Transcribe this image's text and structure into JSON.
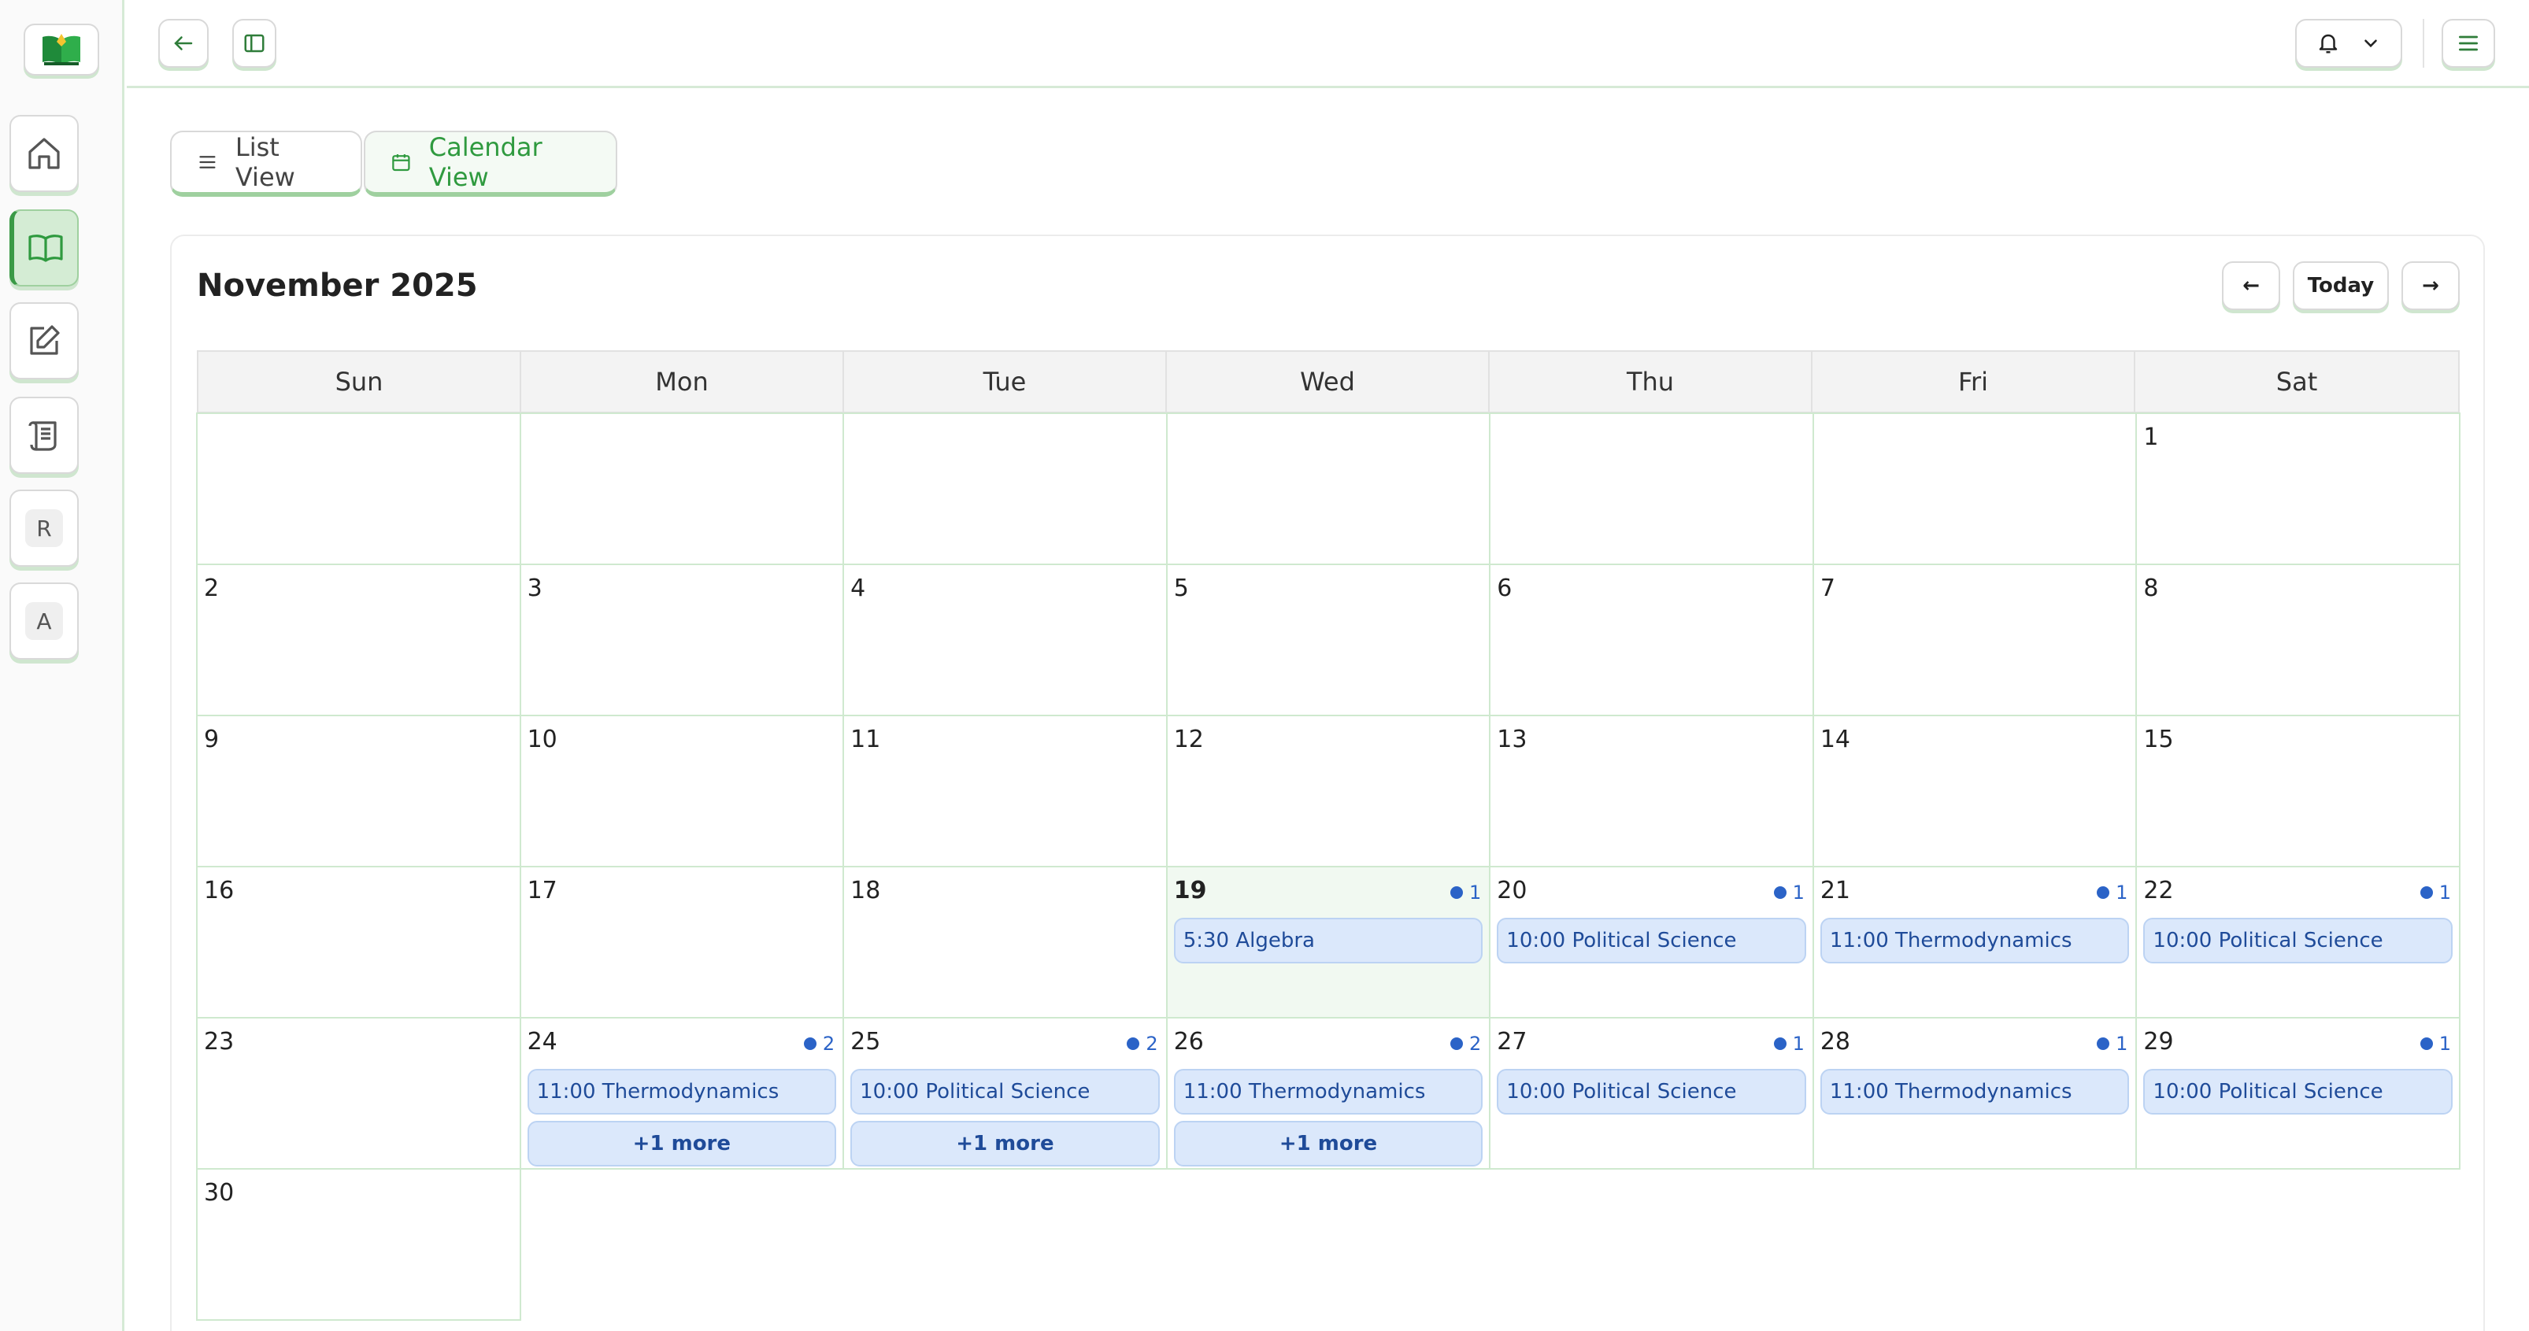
{
  "sidebar": {
    "logo_icon": "open-book-logo",
    "items": [
      {
        "name": "home",
        "icon": "home-icon"
      },
      {
        "name": "courses",
        "icon": "book-icon",
        "active": true
      },
      {
        "name": "edit",
        "icon": "edit-icon"
      },
      {
        "name": "scroll",
        "icon": "scroll-icon"
      },
      {
        "name": "r",
        "letter": "R"
      },
      {
        "name": "a",
        "letter": "A"
      }
    ]
  },
  "topbar": {
    "back_icon": "arrow-left-icon",
    "panel_icon": "panel-icon",
    "notification_icon": "bell-icon",
    "menu_icon": "hamburger-icon"
  },
  "tabs": {
    "list_label": "List View",
    "calendar_label": "Calendar View"
  },
  "calendar": {
    "month_title": "November 2025",
    "prev_label": "←",
    "today_label": "Today",
    "next_label": "→",
    "weekdays": [
      "Sun",
      "Mon",
      "Tue",
      "Wed",
      "Thu",
      "Fri",
      "Sat"
    ],
    "today_day": "19",
    "days": [
      {
        "day": ""
      },
      {
        "day": ""
      },
      {
        "day": ""
      },
      {
        "day": ""
      },
      {
        "day": ""
      },
      {
        "day": ""
      },
      {
        "day": "1"
      },
      {
        "day": "2"
      },
      {
        "day": "3"
      },
      {
        "day": "4"
      },
      {
        "day": "5"
      },
      {
        "day": "6"
      },
      {
        "day": "7"
      },
      {
        "day": "8"
      },
      {
        "day": "9"
      },
      {
        "day": "10"
      },
      {
        "day": "11"
      },
      {
        "day": "12"
      },
      {
        "day": "13"
      },
      {
        "day": "14"
      },
      {
        "day": "15"
      },
      {
        "day": "16"
      },
      {
        "day": "17"
      },
      {
        "day": "18"
      },
      {
        "day": "19",
        "count": "1",
        "events": [
          "5:30 Algebra"
        ]
      },
      {
        "day": "20",
        "count": "1",
        "events": [
          "10:00 Political Science"
        ]
      },
      {
        "day": "21",
        "count": "1",
        "events": [
          "11:00 Thermodynamics"
        ]
      },
      {
        "day": "22",
        "count": "1",
        "events": [
          "10:00 Political Science"
        ]
      },
      {
        "day": "23"
      },
      {
        "day": "24",
        "count": "2",
        "events": [
          "11:00 Thermodynamics"
        ],
        "more": "+1 more"
      },
      {
        "day": "25",
        "count": "2",
        "events": [
          "10:00 Political Science"
        ],
        "more": "+1 more"
      },
      {
        "day": "26",
        "count": "2",
        "events": [
          "11:00 Thermodynamics"
        ],
        "more": "+1 more"
      },
      {
        "day": "27",
        "count": "1",
        "events": [
          "10:00 Political Science"
        ]
      },
      {
        "day": "28",
        "count": "1",
        "events": [
          "11:00 Thermodynamics"
        ]
      },
      {
        "day": "29",
        "count": "1",
        "events": [
          "10:00 Political Science"
        ]
      },
      {
        "day": "30"
      }
    ]
  },
  "colors": {
    "accent_green": "#2f9a3f",
    "event_bg": "#dbe8fb",
    "event_text": "#1f4b99",
    "count_blue": "#2b63c7"
  }
}
